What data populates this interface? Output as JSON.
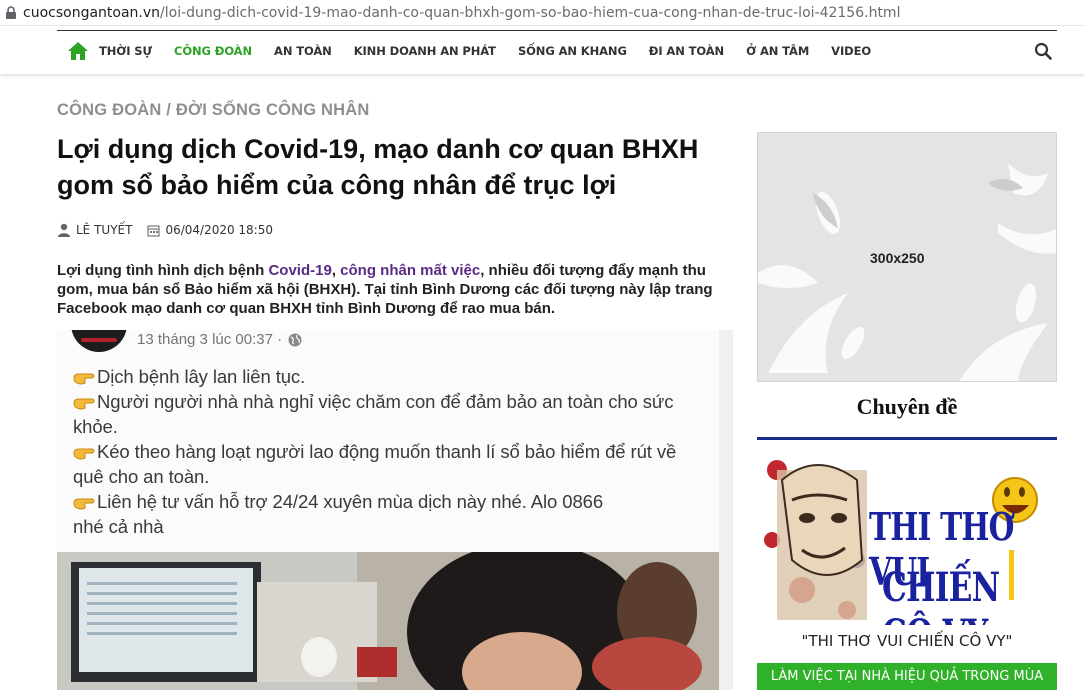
{
  "browser": {
    "url_domain": "cuocsongantoan.vn",
    "url_path": "/loi-dung-dich-covid-19-mao-danh-co-quan-bhxh-gom-so-bao-hiem-cua-cong-nhan-de-truc-loi-42156.html"
  },
  "nav": {
    "items": [
      {
        "label": "THỜI SỰ",
        "active": false
      },
      {
        "label": "CÔNG ĐOÀN",
        "active": true
      },
      {
        "label": "AN TOÀN",
        "active": false
      },
      {
        "label": "KINH DOANH AN PHÁT",
        "active": false
      },
      {
        "label": "SỐNG AN KHANG",
        "active": false
      },
      {
        "label": "ĐI AN TOÀN",
        "active": false
      },
      {
        "label": "Ở AN TÂM",
        "active": false
      },
      {
        "label": "VIDEO",
        "active": false
      }
    ],
    "accent_color": "#2ea325"
  },
  "breadcrumb": {
    "section": "CÔNG ĐOÀN",
    "separator": " / ",
    "subsection": "ĐỜI SỐNG CÔNG NHÂN"
  },
  "article": {
    "title": "Lợi dụng dịch Covid-19, mạo danh cơ quan BHXH gom sổ bảo hiểm của công nhân để trục lợi",
    "author": "LÊ TUYẾT",
    "date": "06/04/2020 18:50",
    "lead": {
      "prefix": "Lợi dụng tình hình dịch bệnh ",
      "link1": "Covid-19",
      "sep": ", ",
      "link2": "công nhân mất việc",
      "suffix": ", nhiều đối tượng đẩy mạnh thu gom, mua bán sổ Bảo hiểm xã hội (BHXH). Tại tỉnh Bình Dương các đối tượng này lập trang Facebook mạo danh cơ quan BHXH tỉnh Bình Dương để rao mua bán."
    },
    "image_post": {
      "time": "13 tháng 3 lúc 00:37 ·",
      "lines": [
        {
          "hand": true,
          "text": "Dịch bệnh lây lan liên tục."
        },
        {
          "hand": true,
          "text": "Người người nhà nhà nghỉ việc chăm con để đảm bảo an toàn cho sức"
        },
        {
          "hand": false,
          "text": "khỏe."
        },
        {
          "hand": true,
          "text": "Kéo theo hàng loạt người lao động muốn thanh lí sổ bảo hiểm để rút về"
        },
        {
          "hand": false,
          "text": "quê cho an toàn."
        },
        {
          "hand": true,
          "text": "Liên hệ tư vấn hỗ trợ 24/24 xuyên mùa dịch này nhé. Alo 0866"
        },
        {
          "hand": false,
          "text": "nhé cả nhà"
        }
      ]
    }
  },
  "sidebar": {
    "ad_size": "300x250",
    "topic_heading": "Chuyên đề",
    "banner_line1": "THI THƠ VUI",
    "banner_line2": "CHIẾN CÔ VY",
    "banner_caption": "\"THI THƠ VUI CHIẾN CÔ VY\"",
    "green_bar_text": "LÀM VIỆC TẠI NHÀ HIỆU QUẢ TRONG MÙA"
  }
}
